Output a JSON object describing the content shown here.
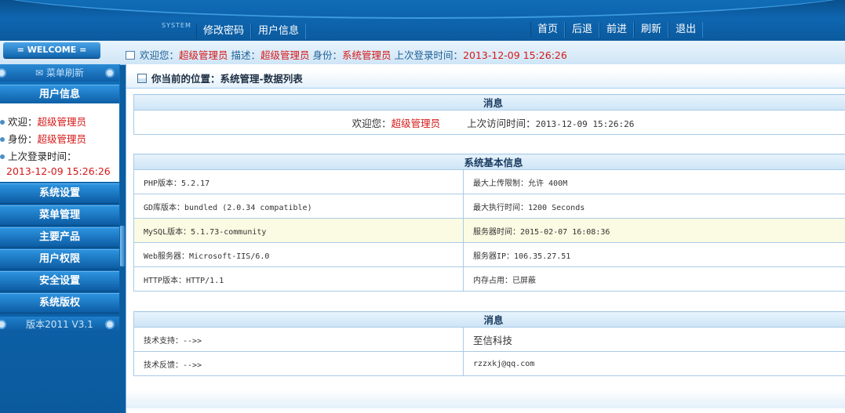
{
  "header": {
    "system_word": "SYSTEM",
    "left_nav": [
      "修改密码",
      "用户信息"
    ],
    "right_nav": [
      "首页",
      "后退",
      "前进",
      "刷新",
      "退出"
    ]
  },
  "welcome_bar": {
    "pill": "= WELCOME =",
    "greet_label": "欢迎您：",
    "greet_value": "超级管理员",
    "desc_label": "描述：",
    "desc_value": "超级管理员",
    "role_label": "身份：",
    "role_value": "系统管理员",
    "last_label": "上次登录时间：",
    "last_value": "2013-12-09 15:26:26"
  },
  "sidebar": {
    "refresh": "菜单刷新",
    "user_head": "用户信息",
    "welcome_label": "欢迎：",
    "welcome_value": "超级管理员",
    "role_label": "身份：",
    "role_value": "超级管理员",
    "last_label": "上次登录时间：",
    "last_value": "2013-12-09 15:26:26",
    "menus": [
      "系统设置",
      "菜单管理",
      "主要产品",
      "用户权限",
      "安全设置",
      "系统版权"
    ],
    "version": "版本2011 V3.1"
  },
  "main": {
    "location": "你当前的位置：系统管理-数据列表",
    "msg1": {
      "title": "消息",
      "welcome_label": "欢迎您：",
      "welcome_value": "超级管理员",
      "last_label": "上次访问时间：",
      "last_value": "2013-12-09 15:26:26"
    },
    "sysinfo": {
      "title": "系统基本信息",
      "rows": [
        [
          "PHP版本：5.2.17",
          "最大上传限制：允许 400M"
        ],
        [
          "GD库版本：bundled (2.0.34 compatible)",
          "最大执行时间：1200 Seconds"
        ],
        [
          "MySQL版本：5.1.73-community",
          "服务器时间：2015-02-07  16:08:36"
        ],
        [
          "Web服务器：Microsoft-IIS/6.0",
          "服务器IP：106.35.27.51"
        ],
        [
          "HTTP版本：HTTP/1.1",
          "内存占用：已屏蔽"
        ]
      ]
    },
    "msg2": {
      "title": "消息",
      "rows": [
        [
          "技术支持：-->>",
          "至信科技"
        ],
        [
          "技术反馈：-->>",
          "rzzxkj@qq.com"
        ]
      ]
    }
  }
}
